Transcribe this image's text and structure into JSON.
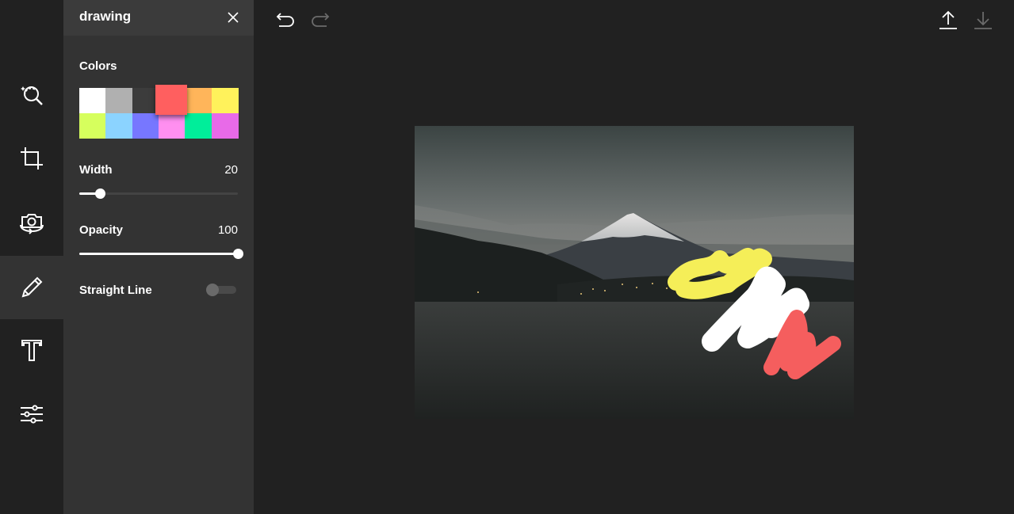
{
  "panel": {
    "title": "drawing",
    "colors_label": "Colors",
    "width_label": "Width",
    "width_value": "20",
    "width_fraction": 0.13,
    "opacity_label": "Opacity",
    "opacity_value": "100",
    "opacity_fraction": 1.0,
    "straight_line_label": "Straight Line",
    "straight_line_on": false
  },
  "palette": {
    "selected": "#ff5f5f",
    "row1": [
      "#ffffff",
      "#b0b0b0",
      "#3c3c3c",
      "#ff5f5f",
      "#ffb55a",
      "#fff25b"
    ],
    "row2": [
      "#d6ff5d",
      "#8bd3ff",
      "#7777ff",
      "#ff8ff0",
      "#00ee9a",
      "#e86ae8"
    ]
  },
  "toolbar": {
    "tools": [
      "filter-tool",
      "crop-tool",
      "rotate-tool",
      "draw-tool",
      "text-tool",
      "adjust-tool"
    ],
    "active": "draw-tool"
  },
  "strokes": {
    "colors": [
      "#f5ee58",
      "#ffffff",
      "#f55e5e"
    ]
  }
}
